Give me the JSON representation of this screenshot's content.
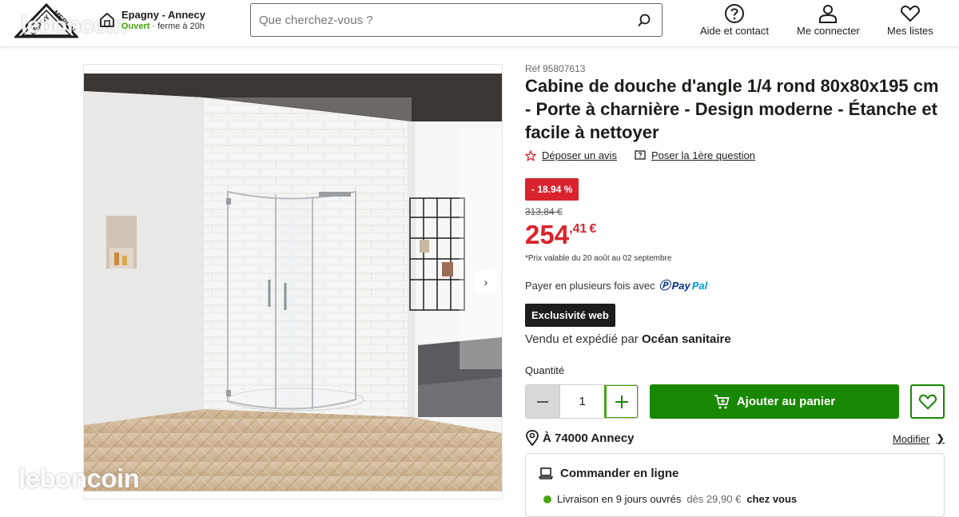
{
  "header": {
    "logo_text": "LEROY MERLIN",
    "watermark": "leboncoin",
    "store": {
      "name": "Epagny - Annecy",
      "status": "Ouvert",
      "hours": "· ferme à 20h"
    },
    "search": {
      "placeholder": "Que cherchez-vous ?",
      "value": ""
    },
    "nav": {
      "help": "Aide et contact",
      "login": "Me connecter",
      "lists": "Mes listes"
    }
  },
  "gallery": {
    "next_icon": "chevron-right-icon",
    "watermark": "leboncoin"
  },
  "product": {
    "ref": "Réf 95807613",
    "title": "Cabine de douche d'angle 1/4 rond 80x80x195 cm - Porte à charnière - Design moderne - Étanche et facile à nettoyer",
    "review_link": "Déposer un avis",
    "question_link": "Poser la 1ère question",
    "discount": "- 18.94 %",
    "old_price": "313,84 €",
    "price_int": "254",
    "price_dec": ",41",
    "price_currency": "€",
    "validity": "*Prix valable du 20 août au 02 septembre",
    "pay_text": "Payer en plusieurs fois avec",
    "paypal_pay": "Pay",
    "paypal_pal": "Pal",
    "exclusive": "Exclusivité web",
    "seller_prefix": "Vendu et expédié par",
    "seller_name": "Océan sanitaire",
    "qty_label": "Quantité",
    "qty_value": "1",
    "add_to_cart": "Ajouter au panier",
    "location": "À 74000 Annecy",
    "modify": "Modifier",
    "order_title": "Commander en ligne",
    "delivery_text": "Livraison en 9 jours ouvrés",
    "delivery_price": "dès 29,90 €",
    "delivery_where": "chez vous"
  },
  "colors": {
    "accent_green": "#188803",
    "promo_red": "#d9232e",
    "dark": "#1d1d1b"
  }
}
